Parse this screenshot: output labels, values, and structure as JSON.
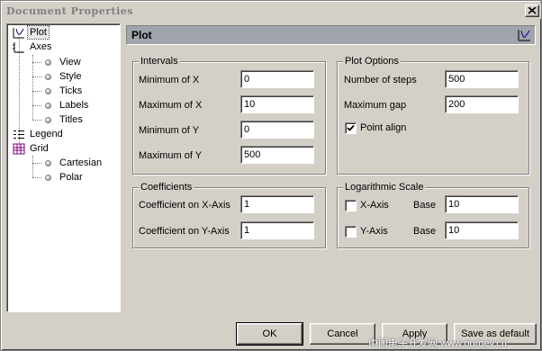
{
  "window": {
    "title": "Document Properties"
  },
  "tree": {
    "items": [
      {
        "label": "Plot",
        "icon": "plot-icon",
        "selected": true
      },
      {
        "label": "Axes",
        "icon": "axes-icon"
      },
      {
        "label": "View",
        "icon": "bullet"
      },
      {
        "label": "Style",
        "icon": "bullet"
      },
      {
        "label": "Ticks",
        "icon": "bullet"
      },
      {
        "label": "Labels",
        "icon": "bullet"
      },
      {
        "label": "Titles",
        "icon": "bullet"
      },
      {
        "label": "Legend",
        "icon": "legend-icon"
      },
      {
        "label": "Grid",
        "icon": "grid-icon"
      },
      {
        "label": "Cartesian",
        "icon": "bullet"
      },
      {
        "label": "Polar",
        "icon": "bullet"
      }
    ]
  },
  "panel": {
    "title": "Plot",
    "icon": "plot-icon"
  },
  "intervals": {
    "title": "Intervals",
    "min_x_label": "Minimum of X",
    "min_x": "0",
    "max_x_label": "Maximum of X",
    "max_x": "10",
    "min_y_label": "Minimum of Y",
    "min_y": "0",
    "max_y_label": "Maximum of Y",
    "max_y": "500"
  },
  "plot_options": {
    "title": "Plot Options",
    "steps_label": "Number of steps",
    "steps": "500",
    "gap_label": "Maximum gap",
    "gap": "200",
    "point_align_label": "Point align",
    "point_align_checked": true
  },
  "coefficients": {
    "title": "Coefficients",
    "x_label": "Coefficient on X-Axis",
    "x": "1",
    "y_label": "Coefficient on Y-Axis",
    "y": "1"
  },
  "log_scale": {
    "title": "Logarithmic Scale",
    "x_axis_label": "X-Axis",
    "x_checked": false,
    "y_axis_label": "Y-Axis",
    "y_checked": false,
    "base_label": "Base",
    "x_base": "10",
    "y_base": "10"
  },
  "buttons": {
    "ok": "OK",
    "cancel": "Cancel",
    "apply": "Apply",
    "save_default": "Save as default"
  },
  "watermark": "中国电子开发网 www.ourdev.cn"
}
